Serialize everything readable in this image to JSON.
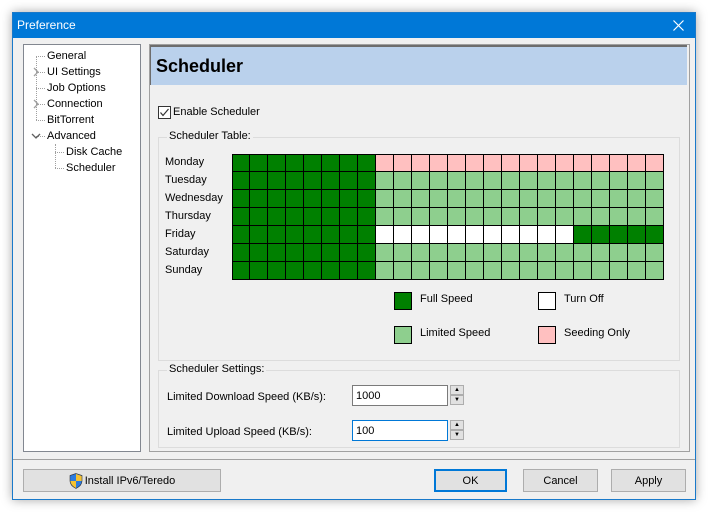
{
  "window": {
    "title": "Preference"
  },
  "tree": {
    "items": [
      {
        "label": "General",
        "level": 0,
        "expander": "none"
      },
      {
        "label": "UI Settings",
        "level": 0,
        "expander": "collapsed"
      },
      {
        "label": "Job Options",
        "level": 0,
        "expander": "none"
      },
      {
        "label": "Connection",
        "level": 0,
        "expander": "collapsed"
      },
      {
        "label": "BitTorrent",
        "level": 0,
        "expander": "none"
      },
      {
        "label": "Advanced",
        "level": 0,
        "expander": "expanded"
      },
      {
        "label": "Disk Cache",
        "level": 1,
        "expander": "none"
      },
      {
        "label": "Scheduler",
        "level": 1,
        "expander": "none",
        "selected": true
      }
    ]
  },
  "page": {
    "title": "Scheduler",
    "enable_label": "Enable Scheduler",
    "enable_checked": true
  },
  "scheduler_table": {
    "label": "Scheduler Table:",
    "days": [
      "Monday",
      "Tuesday",
      "Wednesday",
      "Thursday",
      "Friday",
      "Saturday",
      "Sunday"
    ],
    "hours": 24,
    "colors": {
      "F": "#008000",
      "L": "#8ecf8e",
      "O": "#ffffff",
      "S": "#ffc0c0"
    },
    "rows": [
      "FFFFFFFFSSSSSSSSSSSSSSSS",
      "FFFFFFFFLLLLLLLLLLLLLLLL",
      "FFFFFFFFLLLLLLLLLLLLLLLL",
      "FFFFFFFFLLLLLLLLLLLLLLLL",
      "FFFFFFFFOOOOOOOOOOOFFFFF",
      "FFFFFFFFLLLLLLLLLLLLLLLL",
      "FFFFFFFFLLLLLLLLLLLLLLLL"
    ],
    "legend": [
      {
        "key": "F",
        "label": "Full Speed"
      },
      {
        "key": "O",
        "label": "Turn Off"
      },
      {
        "key": "L",
        "label": "Limited Speed"
      },
      {
        "key": "S",
        "label": "Seeding Only"
      }
    ]
  },
  "scheduler_settings": {
    "label": "Scheduler Settings:",
    "download_label": "Limited Download Speed (KB/s):",
    "download_value": "1000",
    "upload_label": "Limited Upload Speed (KB/s):",
    "upload_value": "100"
  },
  "footer": {
    "install_label": "Install IPv6/Teredo",
    "ok_label": "OK",
    "cancel_label": "Cancel",
    "apply_label": "Apply"
  }
}
